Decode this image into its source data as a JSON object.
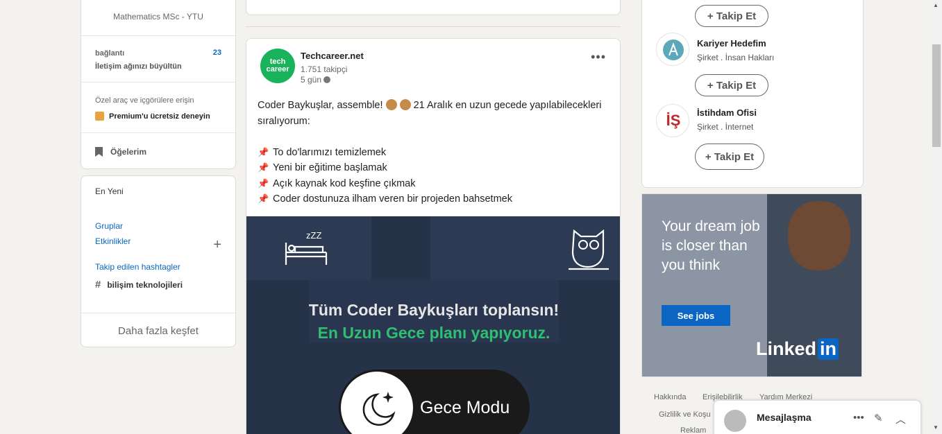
{
  "left": {
    "profile_subtitle": "Mathematics MSc - YTU",
    "connections": {
      "label": "bağlantı",
      "sub": "İletişim ağınızı büyültün",
      "count": "23"
    },
    "premium": {
      "label": "Özel araç ve içgörülere erişin",
      "link": "Premium'u ücretsiz deneyin"
    },
    "items_label": "Öğelerim",
    "recent_label": "En Yeni",
    "groups_label": "Gruplar",
    "events_label": "Etkinlikler",
    "hashtags_label": "Takip edilen hashtagler",
    "hashtag": "bilişim teknolojileri",
    "discover_more": "Daha fazla keşfet"
  },
  "post": {
    "logo_text_1": "tech",
    "logo_text_2": "career",
    "author": "Techcareer.net",
    "followers": "1.751 takipçi",
    "age": "5 gün",
    "text_before_emoji": "Coder Baykuşlar, assemble! ",
    "text_after_emoji": " 21 Aralık en uzun gecede yapılabilecekleri sıralıyorum:",
    "bullets": [
      "To do'larımızı temizlemek",
      "Yeni bir eğitime başlamak",
      "Açık kaynak kod keşfine çıkmak",
      "Coder dostunuza ilham veren bir projeden bahsetmek"
    ],
    "image": {
      "zzz": "zZZ",
      "line1": "Tüm Coder Baykuşları toplansın!",
      "line2": "En Uzun Gece planı yapıyoruz.",
      "night_mode": "Gece Modu"
    }
  },
  "right": {
    "follow_label": "+ Takip Et",
    "companies": [
      {
        "name": "Kariyer Hedefim",
        "meta": "Şirket . İnsan Hakları"
      },
      {
        "name": "İstihdam Ofisi",
        "meta": "Şirket . İnternet"
      }
    ],
    "istihdam_logo_text": "İŞ",
    "ad": {
      "text": "Your dream job is closer than you think",
      "button": "See jobs",
      "brand": "Linked",
      "brand_in": "in"
    },
    "footer_links": [
      "Hakkında",
      "Erişilebilirlik",
      "Yardım Merkezi",
      "Gizlilik ve Koşu",
      "Reklam"
    ]
  },
  "messaging": {
    "title": "Mesajlaşma"
  },
  "colors": {
    "accent": "#0a66c2",
    "brand_green": "#19b35c",
    "image_bg": "#263247"
  }
}
